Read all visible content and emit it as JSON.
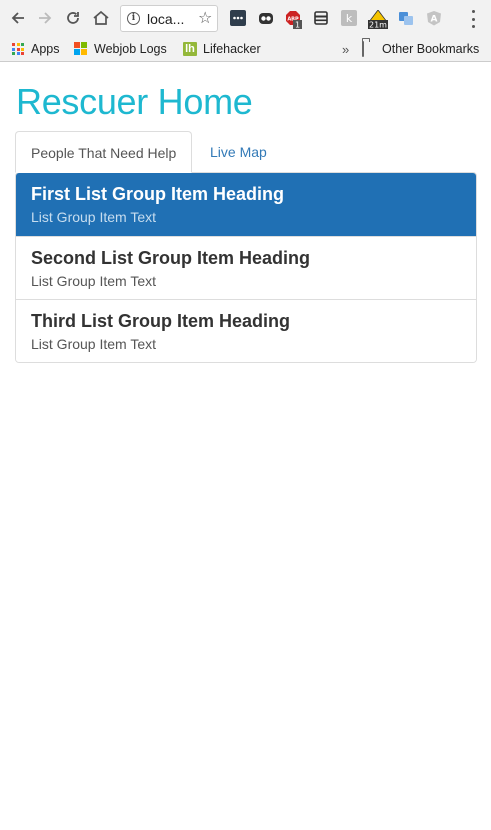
{
  "browser": {
    "url_display": "loca...",
    "extensions": [
      {
        "name": "ext-dots",
        "color": "#444444"
      },
      {
        "name": "ext-owl",
        "color": "#333333"
      },
      {
        "name": "ext-adblock",
        "color": "#cc2222",
        "badge": "1"
      },
      {
        "name": "ext-print",
        "color": "#333333"
      },
      {
        "name": "ext-k",
        "color": "#bbbbbb"
      },
      {
        "name": "ext-warning",
        "color": "#f5c400",
        "badge": "21m"
      },
      {
        "name": "ext-translate",
        "color": "#4a8fd8"
      },
      {
        "name": "ext-angular",
        "color": "#bbbbbb"
      }
    ],
    "bookmarks": {
      "apps_label": "Apps",
      "items": [
        {
          "label": "Webjob Logs",
          "icon": "microsoft-icon"
        },
        {
          "label": "Lifehacker",
          "icon": "lifehacker-icon"
        }
      ],
      "overflow_label": "»",
      "other_label": "Other Bookmarks"
    }
  },
  "page": {
    "title": "Rescuer Home",
    "tabs": [
      {
        "label": "People That Need Help",
        "active": true
      },
      {
        "label": "Live Map",
        "active": false
      }
    ],
    "list_items": [
      {
        "heading": "First List Group Item Heading",
        "text": "List Group Item Text",
        "active": true
      },
      {
        "heading": "Second List Group Item Heading",
        "text": "List Group Item Text",
        "active": false
      },
      {
        "heading": "Third List Group Item Heading",
        "text": "List Group Item Text",
        "active": false
      }
    ]
  },
  "colors": {
    "title": "#1eb8d0",
    "active_item": "#2070b4",
    "link": "#337ab7"
  }
}
